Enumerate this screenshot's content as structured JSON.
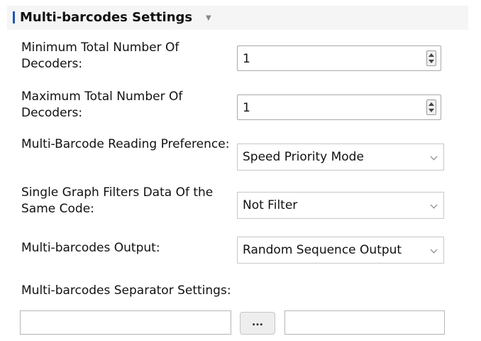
{
  "section": {
    "title": "Multi-barcodes Settings"
  },
  "fields": {
    "min_decoders": {
      "label": "Minimum Total Number Of Decoders:",
      "value": "1"
    },
    "max_decoders": {
      "label": "Maximum Total Number Of Decoders:",
      "value": "1"
    },
    "reading_preference": {
      "label": "Multi-Barcode Reading Preference:",
      "value": "Speed Priority Mode"
    },
    "filter_same_code": {
      "label": "Single Graph Filters Data Of the Same Code:",
      "value": "Not Filter"
    },
    "output": {
      "label": "Multi-barcodes Output:",
      "value": "Random Sequence Output"
    },
    "separator": {
      "label": "Multi-barcodes Separator Settings:",
      "browse_label": "...",
      "left_value": "",
      "right_value": ""
    }
  },
  "colors": {
    "accent": "#1f55b5",
    "header_background": "#f5f5f5"
  },
  "icons": {
    "collapse": "caret-down-icon",
    "spinner": "spinner-arrows-icon",
    "dropdown": "chevron-down-icon"
  }
}
